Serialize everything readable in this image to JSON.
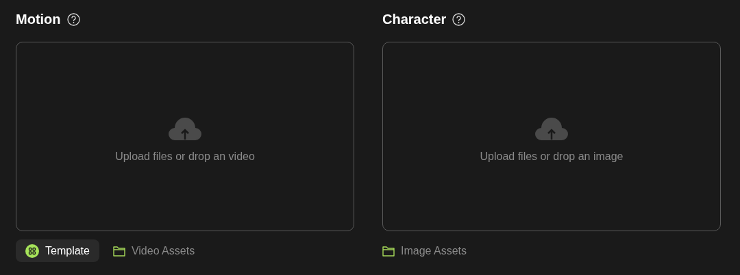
{
  "panels": [
    {
      "title": "Motion",
      "dropzone": {
        "text": "Upload files or drop an video"
      },
      "buttons": [
        {
          "kind": "template",
          "label": "Template",
          "selected": true
        },
        {
          "kind": "folder",
          "label": "Video Assets",
          "selected": false
        }
      ]
    },
    {
      "title": "Character",
      "dropzone": {
        "text": "Upload files or drop an image"
      },
      "buttons": [
        {
          "kind": "folder",
          "label": "Image Assets",
          "selected": false
        }
      ]
    }
  ]
}
